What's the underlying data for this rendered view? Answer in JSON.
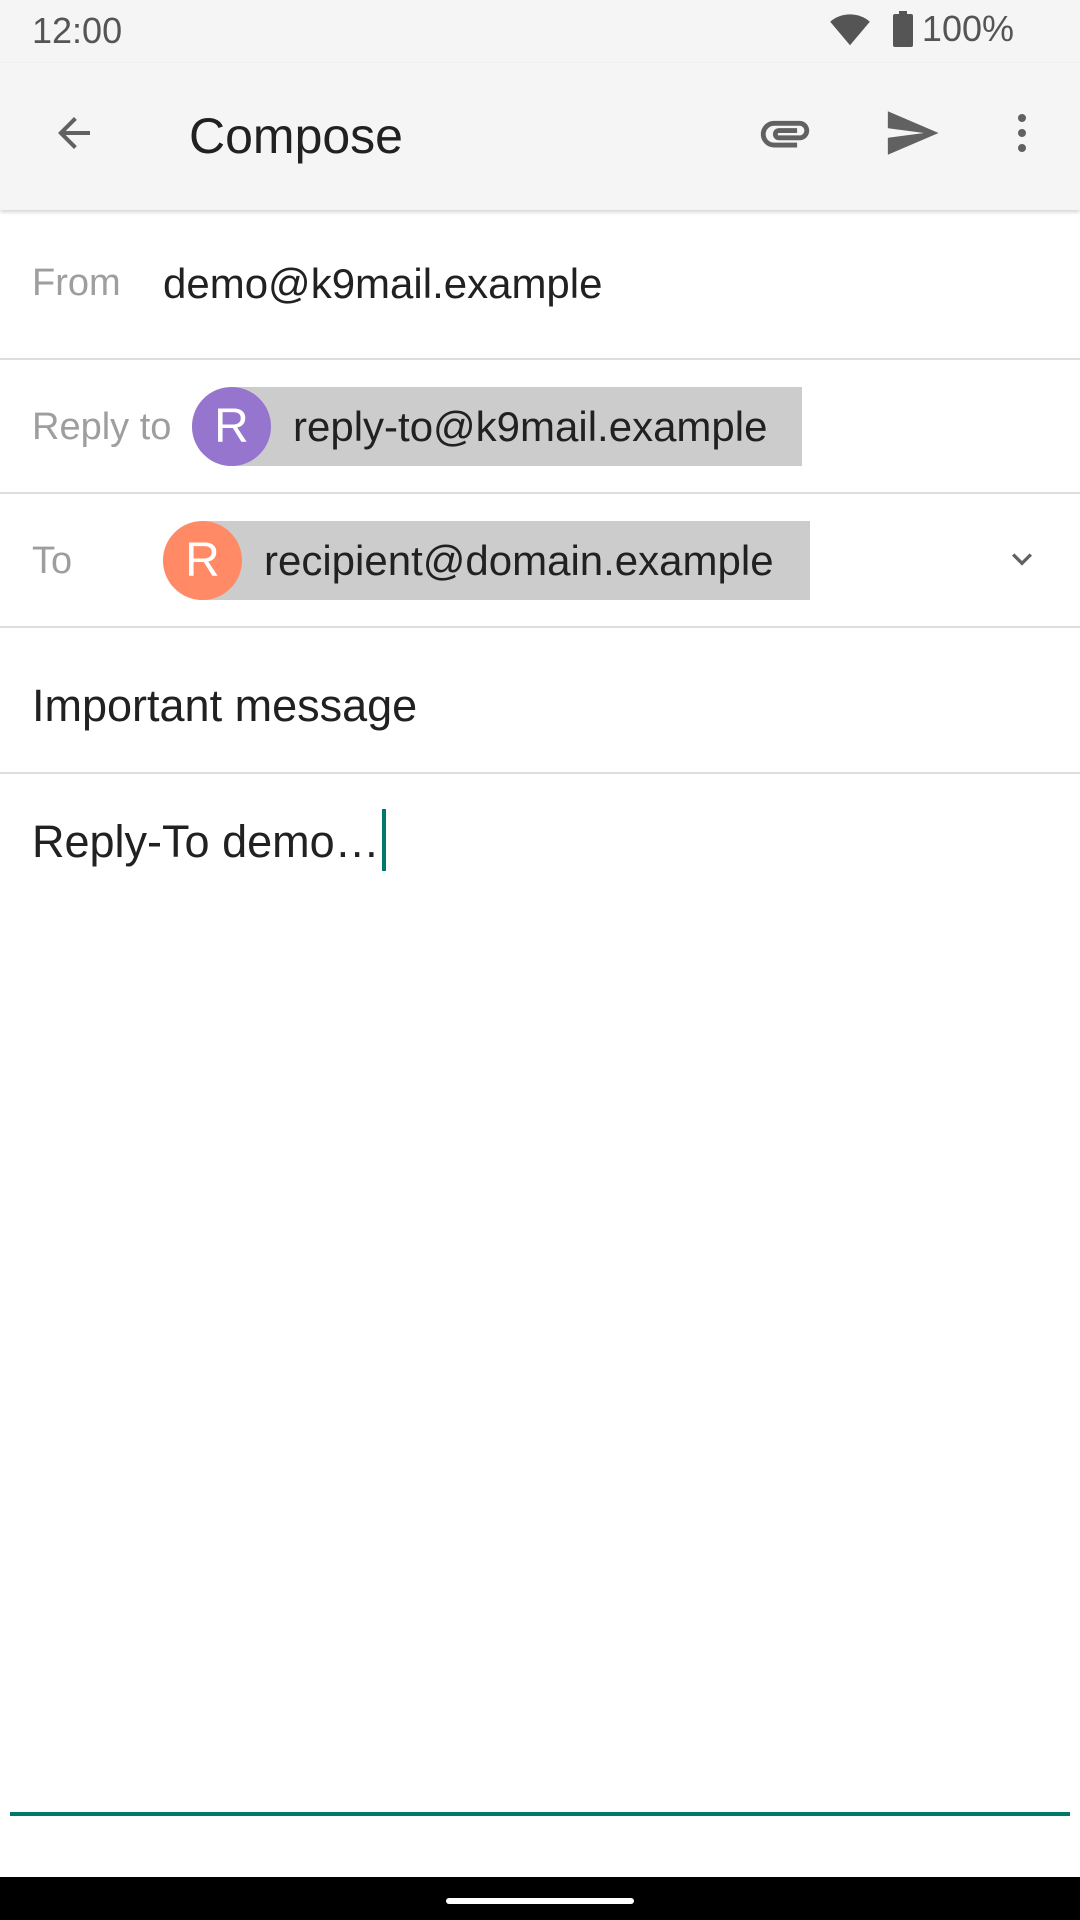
{
  "status_bar": {
    "time": "12:00",
    "battery": "100%",
    "icons": [
      "wifi-icon",
      "battery-icon"
    ]
  },
  "app_bar": {
    "title": "Compose",
    "icons": [
      "back-arrow-icon",
      "paperclip-icon",
      "send-icon",
      "more-vert-icon"
    ]
  },
  "from": {
    "label": "From",
    "value": "demo@k9mail.example"
  },
  "reply_to": {
    "label": "Reply to",
    "chip": {
      "avatar_letter": "R",
      "avatar_color": "#9575cd",
      "address": "reply-to@k9mail.example"
    }
  },
  "to": {
    "label": "To",
    "chip": {
      "avatar_letter": "R",
      "avatar_color": "#ff8a65",
      "address": "recipient@domain.example"
    },
    "expand_icon": "chevron-down-icon"
  },
  "subject": {
    "value": "Important message"
  },
  "body": {
    "value": "Reply-To demo…"
  },
  "colors": {
    "accent": "#00796b",
    "app_bar_bg": "#f5f5f5",
    "chip_bg": "#cccccc"
  }
}
